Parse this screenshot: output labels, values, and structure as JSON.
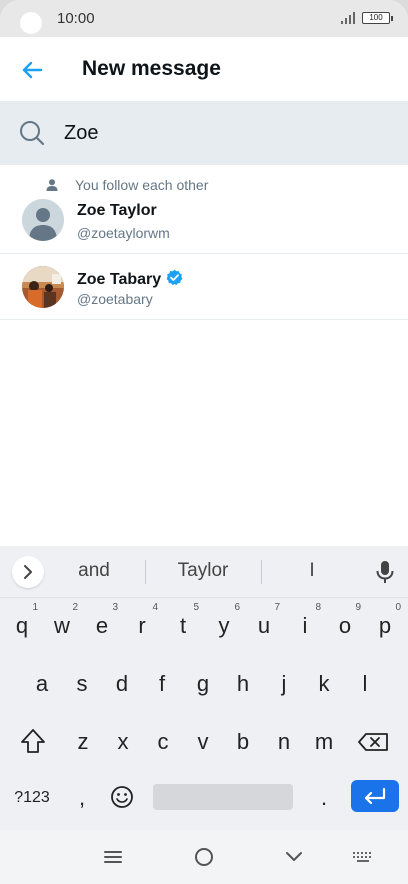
{
  "status": {
    "time": "10:00",
    "battery": "100"
  },
  "header": {
    "title": "New message"
  },
  "search": {
    "value": "Zoe",
    "icon": "search-icon"
  },
  "results": [
    {
      "social_context": "You follow each other",
      "name": "Zoe Taylor",
      "handle": "@zoetaylorwm",
      "verified": false
    },
    {
      "social_context": "",
      "name": "Zoe Tabary",
      "handle": "@zoetabary",
      "verified": true
    }
  ],
  "keyboard": {
    "suggestions": [
      "and",
      "Taylor",
      "I"
    ],
    "row1": [
      {
        "key": "q",
        "hint": "1"
      },
      {
        "key": "w",
        "hint": "2"
      },
      {
        "key": "e",
        "hint": "3"
      },
      {
        "key": "r",
        "hint": "4"
      },
      {
        "key": "t",
        "hint": "5"
      },
      {
        "key": "y",
        "hint": "6"
      },
      {
        "key": "u",
        "hint": "7"
      },
      {
        "key": "i",
        "hint": "8"
      },
      {
        "key": "o",
        "hint": "9"
      },
      {
        "key": "p",
        "hint": "0"
      }
    ],
    "row2": [
      "a",
      "s",
      "d",
      "f",
      "g",
      "h",
      "j",
      "k",
      "l"
    ],
    "row3": [
      "z",
      "x",
      "c",
      "v",
      "b",
      "n",
      "m"
    ],
    "symbols_label": "?123",
    "comma": ",",
    "period": "."
  },
  "colors": {
    "accent": "#1da1f2",
    "enter": "#1a73e8",
    "search_bg": "#e6ecf0"
  }
}
